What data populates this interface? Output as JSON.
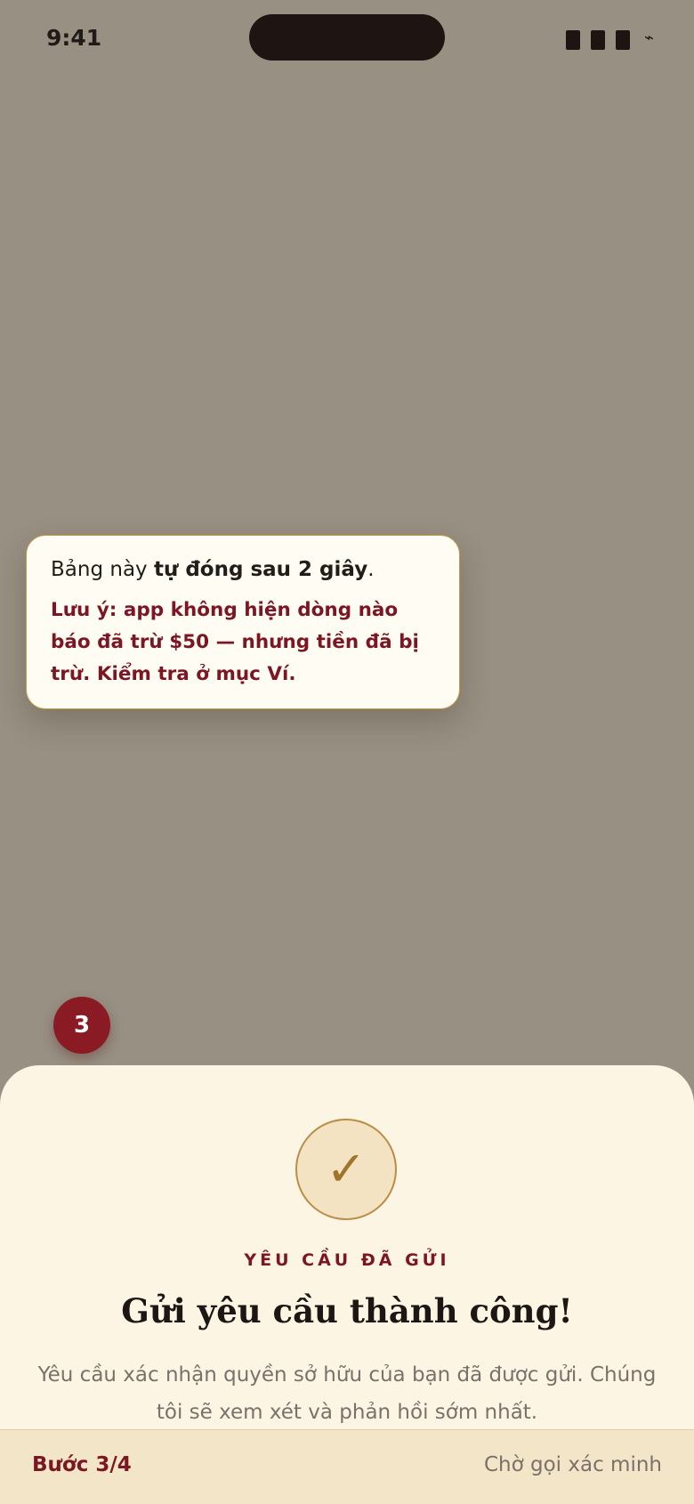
{
  "status_bar": {
    "time": "9:41",
    "charging_glyph": "⌁"
  },
  "popover": {
    "line1_prefix": "Bảng này ",
    "line1_bold": "tự đóng sau 2 giây",
    "line1_suffix": ".",
    "warning": "Lưu ý: app không hiện dòng nào báo đã trừ $50 — nhưng tiền đã bị trừ. Kiểm tra ở mục Ví."
  },
  "step_badge": "3",
  "sheet": {
    "check_glyph": "✓",
    "eyebrow": "YÊU CẦU ĐÃ GỬI",
    "title": "Gửi yêu cầu thành công!",
    "body": "Yêu cầu xác nhận quyền sở hữu của bạn đã được gửi. Chúng tôi sẽ xem xét và phản hồi sớm nhất."
  },
  "footer": {
    "step": "Bước 3/4",
    "status": "Chờ gọi xác minh"
  },
  "colors": {
    "overlay": "#979083",
    "accent": "#7b1622",
    "gold": "#c79a45",
    "sheet_bg": "#fcf5e3"
  }
}
